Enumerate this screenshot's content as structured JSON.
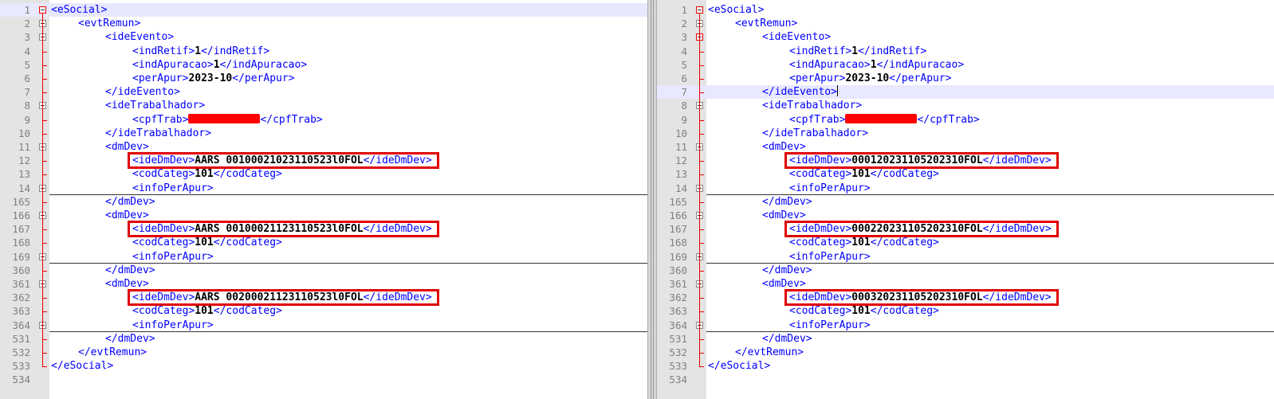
{
  "left_pane": {
    "lines": [
      {
        "num": "1",
        "indent": 0,
        "pre": "<eSocial>",
        "val": "",
        "post": "",
        "hl": true
      },
      {
        "num": "2",
        "indent": 1,
        "pre": "<evtRemun>",
        "val": "",
        "post": ""
      },
      {
        "num": "3",
        "indent": 2,
        "pre": "<ideEvento>",
        "val": "",
        "post": ""
      },
      {
        "num": "4",
        "indent": 3,
        "pre": "<indRetif>",
        "val": "1",
        "post": "</indRetif>"
      },
      {
        "num": "5",
        "indent": 3,
        "pre": "<indApuracao>",
        "val": "1",
        "post": "</indApuracao>"
      },
      {
        "num": "6",
        "indent": 3,
        "pre": "<perApur>",
        "val": "2023-10",
        "post": "</perApur>"
      },
      {
        "num": "7",
        "indent": 2,
        "pre": "</ideEvento>",
        "val": "",
        "post": ""
      },
      {
        "num": "8",
        "indent": 2,
        "pre": "<ideTrabalhador>",
        "val": "",
        "post": ""
      },
      {
        "num": "9",
        "indent": 3,
        "pre": "<cpfTrab>",
        "val": "",
        "post": "</cpfTrab>",
        "redacted": true
      },
      {
        "num": "10",
        "indent": 2,
        "pre": "</ideTrabalhador>",
        "val": "",
        "post": ""
      },
      {
        "num": "11",
        "indent": 2,
        "pre": "<dmDev>",
        "val": "",
        "post": ""
      },
      {
        "num": "12",
        "indent": 3,
        "pre": "<ideDmDev>",
        "val": "AARS 00100021023110523l0FOL",
        "post": "</ideDmDev>"
      },
      {
        "num": "13",
        "indent": 3,
        "pre": "<codCateg>",
        "val": "101",
        "post": "</codCateg>"
      },
      {
        "num": "14",
        "indent": 3,
        "pre": "<infoPerApur>",
        "val": "",
        "post": ""
      },
      {
        "num": "165",
        "indent": 2,
        "pre": "</dmDev>",
        "val": "",
        "post": ""
      },
      {
        "num": "166",
        "indent": 2,
        "pre": "<dmDev>",
        "val": "",
        "post": ""
      },
      {
        "num": "167",
        "indent": 3,
        "pre": "<ideDmDev>",
        "val": "AARS 00100021123110523l0FOL",
        "post": "</ideDmDev>"
      },
      {
        "num": "168",
        "indent": 3,
        "pre": "<codCateg>",
        "val": "101",
        "post": "</codCateg>"
      },
      {
        "num": "169",
        "indent": 3,
        "pre": "<infoPerApur>",
        "val": "",
        "post": ""
      },
      {
        "num": "360",
        "indent": 2,
        "pre": "</dmDev>",
        "val": "",
        "post": ""
      },
      {
        "num": "361",
        "indent": 2,
        "pre": "<dmDev>",
        "val": "",
        "post": ""
      },
      {
        "num": "362",
        "indent": 3,
        "pre": "<ideDmDev>",
        "val": "AARS 00200021123110523l0FOL",
        "post": "</ideDmDev>"
      },
      {
        "num": "363",
        "indent": 3,
        "pre": "<codCateg>",
        "val": "101",
        "post": "</codCateg>"
      },
      {
        "num": "364",
        "indent": 3,
        "pre": "<infoPerApur>",
        "val": "",
        "post": ""
      },
      {
        "num": "531",
        "indent": 2,
        "pre": "</dmDev>",
        "val": "",
        "post": ""
      },
      {
        "num": "532",
        "indent": 1,
        "pre": "</evtRemun>",
        "val": "",
        "post": ""
      },
      {
        "num": "533",
        "indent": 0,
        "pre": "</eSocial>",
        "val": "",
        "post": ""
      },
      {
        "num": "534",
        "indent": 0,
        "pre": "",
        "val": "",
        "post": ""
      }
    ]
  },
  "right_pane": {
    "lines": [
      {
        "num": "1",
        "indent": 0,
        "pre": "<eSocial>",
        "val": "",
        "post": ""
      },
      {
        "num": "2",
        "indent": 1,
        "pre": "<evtRemun>",
        "val": "",
        "post": ""
      },
      {
        "num": "3",
        "indent": 2,
        "pre": "<ideEvento>",
        "val": "",
        "post": ""
      },
      {
        "num": "4",
        "indent": 3,
        "pre": "<indRetif>",
        "val": "1",
        "post": "</indRetif>"
      },
      {
        "num": "5",
        "indent": 3,
        "pre": "<indApuracao>",
        "val": "1",
        "post": "</indApuracao>"
      },
      {
        "num": "6",
        "indent": 3,
        "pre": "<perApur>",
        "val": "2023-10",
        "post": "</perApur>"
      },
      {
        "num": "7",
        "indent": 2,
        "pre": "</ideEvento>",
        "val": "",
        "post": "",
        "hl": true,
        "caret": true
      },
      {
        "num": "8",
        "indent": 2,
        "pre": "<ideTrabalhador>",
        "val": "",
        "post": ""
      },
      {
        "num": "9",
        "indent": 3,
        "pre": "<cpfTrab>",
        "val": "",
        "post": "</cpfTrab>",
        "redacted": true
      },
      {
        "num": "10",
        "indent": 2,
        "pre": "</ideTrabalhador>",
        "val": "",
        "post": ""
      },
      {
        "num": "11",
        "indent": 2,
        "pre": "<dmDev>",
        "val": "",
        "post": ""
      },
      {
        "num": "12",
        "indent": 3,
        "pre": "<ideDmDev>",
        "val": "000120231105202310FOL",
        "post": "</ideDmDev>"
      },
      {
        "num": "13",
        "indent": 3,
        "pre": "<codCateg>",
        "val": "101",
        "post": "</codCateg>"
      },
      {
        "num": "14",
        "indent": 3,
        "pre": "<infoPerApur>",
        "val": "",
        "post": ""
      },
      {
        "num": "165",
        "indent": 2,
        "pre": "</dmDev>",
        "val": "",
        "post": ""
      },
      {
        "num": "166",
        "indent": 2,
        "pre": "<dmDev>",
        "val": "",
        "post": ""
      },
      {
        "num": "167",
        "indent": 3,
        "pre": "<ideDmDev>",
        "val": "000220231105202310FOL",
        "post": "</ideDmDev>"
      },
      {
        "num": "168",
        "indent": 3,
        "pre": "<codCateg>",
        "val": "101",
        "post": "</codCateg>"
      },
      {
        "num": "169",
        "indent": 3,
        "pre": "<infoPerApur>",
        "val": "",
        "post": ""
      },
      {
        "num": "360",
        "indent": 2,
        "pre": "</dmDev>",
        "val": "",
        "post": ""
      },
      {
        "num": "361",
        "indent": 2,
        "pre": "<dmDev>",
        "val": "",
        "post": ""
      },
      {
        "num": "362",
        "indent": 3,
        "pre": "<ideDmDev>",
        "val": "000320231105202310FOL",
        "post": "</ideDmDev>"
      },
      {
        "num": "363",
        "indent": 3,
        "pre": "<codCateg>",
        "val": "101",
        "post": "</codCateg>"
      },
      {
        "num": "364",
        "indent": 3,
        "pre": "<infoPerApur>",
        "val": "",
        "post": ""
      },
      {
        "num": "531",
        "indent": 2,
        "pre": "</dmDev>",
        "val": "",
        "post": ""
      },
      {
        "num": "532",
        "indent": 1,
        "pre": "</evtRemun>",
        "val": "",
        "post": ""
      },
      {
        "num": "533",
        "indent": 0,
        "pre": "</eSocial>",
        "val": "",
        "post": ""
      },
      {
        "num": "534",
        "indent": 0,
        "pre": "",
        "val": "",
        "post": ""
      }
    ]
  },
  "colors": {
    "tag": "#0000ff",
    "value": "#000000",
    "highlight_box": "#e00000",
    "redaction": "#ff0000",
    "current_line": "#e8e8ff"
  }
}
